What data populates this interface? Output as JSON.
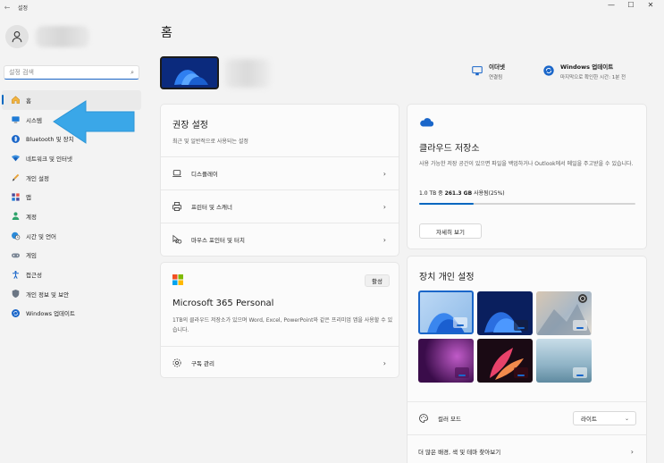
{
  "window": {
    "title": "설정",
    "back": "←",
    "minimize": "—",
    "maximize": "☐",
    "close": "✕"
  },
  "sidebar": {
    "search_placeholder": "설정 검색",
    "items": [
      {
        "label": "홈",
        "icon": "home-icon"
      },
      {
        "label": "시스템",
        "icon": "monitor-icon"
      },
      {
        "label": "Bluetooth 및 장치",
        "icon": "bluetooth-icon"
      },
      {
        "label": "네트워크 및 인터넷",
        "icon": "wifi-icon"
      },
      {
        "label": "개인 설정",
        "icon": "brush-icon"
      },
      {
        "label": "앱",
        "icon": "apps-icon"
      },
      {
        "label": "계정",
        "icon": "account-icon"
      },
      {
        "label": "시간 및 언어",
        "icon": "globe-clock-icon"
      },
      {
        "label": "게임",
        "icon": "gamepad-icon"
      },
      {
        "label": "접근성",
        "icon": "accessibility-icon"
      },
      {
        "label": "개인 정보 및 보안",
        "icon": "shield-icon"
      },
      {
        "label": "Windows 업데이트",
        "icon": "update-icon"
      }
    ]
  },
  "main": {
    "title": "홈",
    "status": {
      "ethernet": {
        "title": "이더넷",
        "sub": "연결됨"
      },
      "update": {
        "title": "Windows 업데이트",
        "sub": "마지막으로 확인한 시간: 1분 전"
      }
    },
    "recommended": {
      "title": "권장 설정",
      "subtitle": "최근 및 일반적으로 사용되는 설정",
      "rows": [
        "디스플레이",
        "프린터 및 스캐너",
        "마우스 포인터 및 터치"
      ]
    },
    "m365": {
      "badge": "활성",
      "title": "Microsoft 365 Personal",
      "desc": "1TB의 클라우드 저장소가 있으며 Word, Excel, PowerPoint와 같은 프리미엄 앱을 사용할 수 있습니다.",
      "row": "구독 관리"
    },
    "cloud": {
      "title": "클라우드 저장소",
      "desc": "사용 가능한 저장 공간이 있으면 파일을 백업하거나 Outlook에서 메일을 주고받을 수 있습니다.",
      "usage_prefix": "1.0 TB 중 ",
      "usage_value": "261.3 GB",
      "usage_suffix": " 사용됨(25%)",
      "used_fraction": 0.25,
      "button": "자세히 보기"
    },
    "personalize": {
      "title": "장치 개인 설정",
      "color_mode_label": "컬러 모드",
      "color_mode_value": "라이트",
      "more_row": "더 많은 배경, 색 및 테마 찾아보기"
    }
  },
  "colors": {
    "accent": "#0067c0",
    "annotation_arrow": "#3aa7e8"
  }
}
